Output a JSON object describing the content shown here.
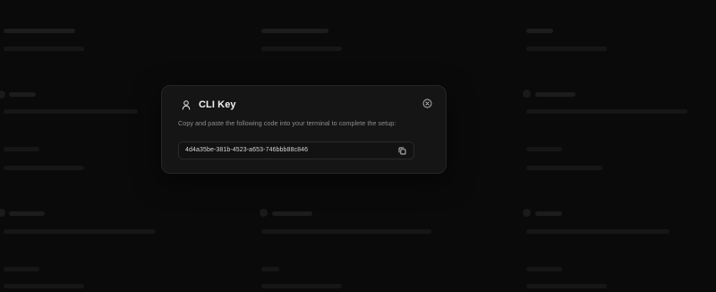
{
  "modal": {
    "title": "CLI Key",
    "description": "Copy and paste the following code into your terminal to complete the setup:",
    "key_value": "4d4a35be-381b-4523-a653-746bbb88c846",
    "icons": {
      "header": "user-icon",
      "close": "close-circle-icon",
      "copy": "copy-icon"
    }
  },
  "colors": {
    "background": "#0a0a0a",
    "modal_background": "#151515",
    "modal_border": "#262626",
    "title_text": "#f2f2f2",
    "muted_text": "#8c8c8c"
  }
}
